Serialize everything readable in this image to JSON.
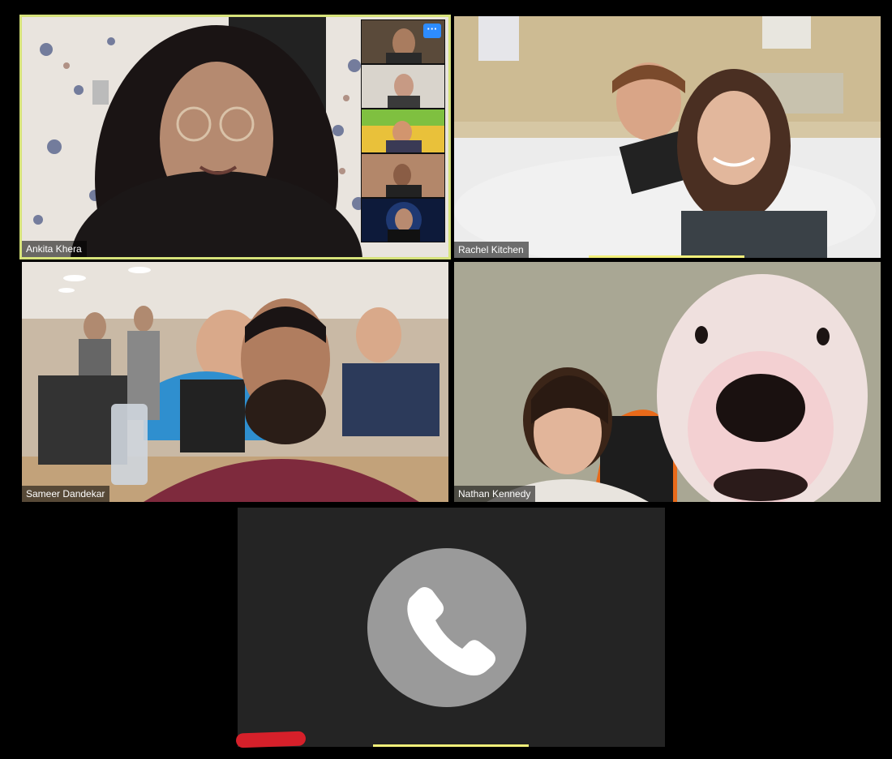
{
  "participants": [
    {
      "name": "Ankita Khera"
    },
    {
      "name": "Rachel Kitchen"
    },
    {
      "name": "Sameer Dandekar"
    },
    {
      "name": "Nathan Kennedy"
    }
  ],
  "thumbnail_count": 5,
  "more_options_label": "···",
  "phone_tile": {
    "icon": "phone-icon"
  },
  "colors": {
    "active_speaker_border": "#d6e27a",
    "speaking_indicator": "#f2f07a",
    "more_button": "#2d8cff",
    "annotation_mark": "#d6202a"
  }
}
